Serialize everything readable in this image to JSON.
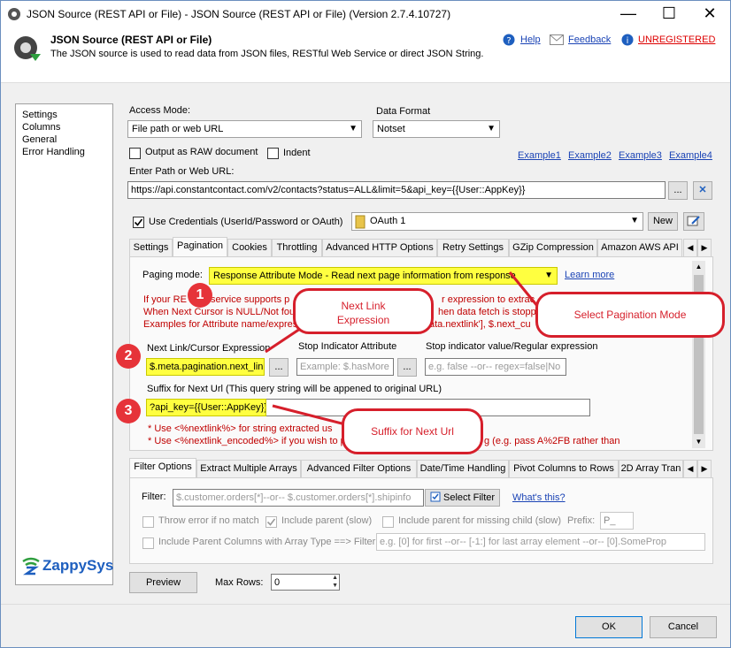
{
  "window": {
    "title": "JSON Source (REST API or File) - JSON Source (REST API or File) (Version 2.7.4.10727)",
    "minimize": "—",
    "maximize": "☐",
    "close": "✕"
  },
  "header": {
    "title": "JSON Source (REST API or File)",
    "description": "The JSON source is used to read data from JSON files, RESTful Web Service or direct JSON String.",
    "help": "Help",
    "feedback": "Feedback",
    "unregistered": "UNREGISTERED"
  },
  "leftnav": {
    "items": [
      "Settings",
      "Columns",
      "General",
      "Error Handling"
    ]
  },
  "access_mode": {
    "label": "Access Mode:",
    "value": "File path or web URL"
  },
  "data_format": {
    "label": "Data Format",
    "value": "Notset"
  },
  "output_raw": {
    "label": "Output as RAW document"
  },
  "indent": {
    "label": "Indent"
  },
  "examples": [
    "Example1",
    "Example2",
    "Example3",
    "Example4"
  ],
  "path": {
    "label": "Enter Path or Web URL:",
    "value": "https://api.constantcontact.com/v2/contacts?status=ALL&limit=5&api_key={{User::AppKey}}",
    "browse": "...",
    "clear": "✕"
  },
  "credentials": {
    "label": "Use Credentials (UserId/Password or OAuth)",
    "value": "OAuth 1",
    "new": "New"
  },
  "tabs": [
    "Settings",
    "Pagination",
    "Cookies",
    "Throttling",
    "Advanced HTTP Options",
    "Retry Settings",
    "GZip Compression",
    "Amazon AWS API"
  ],
  "pagination": {
    "paging_label": "Paging mode:",
    "paging_value": "Response Attribute Mode - Read next page information from response",
    "learn_more": "Learn more",
    "info_1a": "If your RE",
    "info_1b": "service supports p",
    "info_1c": "r expression to extrac",
    "info_2a": "When Next Cursor is NULL/Not fou",
    "info_2b": "hen data fetch is stopp",
    "info_3a": "Examples for Attribute name/expres",
    "info_3b": "ata.nextlink'], $.next_cu",
    "next_link_label": "Next Link/Cursor Expression",
    "next_link_value": "$.meta.pagination.next_link",
    "stop_attr_label": "Stop Indicator Attribute",
    "stop_attr_ph": "Example:  $.hasMore",
    "stop_val_label": "Stop indicator value/Regular expression",
    "stop_val_ph": "e.g. false --or-- regex=false|No",
    "suffix_label": "Suffix for Next Url  (This query string will be appened to original URL)",
    "suffix_value": "?api_key={{User::AppKey}}",
    "note_1a": "* Use <%nextlink%> for string extracted us",
    "note_2a": "* Use <%nextlink_encoded%> if you wish to p",
    "note_2b": "g (e.g. pass A%2FB rather than",
    "browse": "..."
  },
  "callouts": {
    "next_link": "Next Link\nExpression",
    "select_mode": "Select Pagination Mode",
    "suffix": "Suffix for Next Url",
    "n1": "1",
    "n2": "2",
    "n3": "3"
  },
  "filter_tabs": [
    "Filter Options",
    "Extract Multiple Arrays",
    "Advanced Filter Options",
    "Date/Time Handling",
    "Pivot Columns to Rows",
    "2D Array Tran"
  ],
  "filter": {
    "label": "Filter:",
    "placeholder": "$.customer.orders[*]--or-- $.customer.orders[*].shipinfo",
    "select": "Select Filter",
    "whats_this": "What's this?",
    "throw_error": "Throw error if no match",
    "include_parent": "Include parent (slow)",
    "include_missing": "Include parent for missing child (slow)",
    "prefix_label": "Prefix:",
    "prefix_value": "P_",
    "include_cols": "Include Parent Columns with Array Type ==> Filter :",
    "include_cols_ph": "e.g. [0] for first --or-- [-1:] for last array element --or-- [0].SomeProp"
  },
  "logo": {
    "text": "ZappySys"
  },
  "footer": {
    "preview": "Preview",
    "max_rows_label": "Max Rows:",
    "max_rows": "0",
    "ok": "OK",
    "cancel": "Cancel"
  },
  "colors": {
    "accent_red": "#d61f2b",
    "highlight": "#ffff40",
    "link": "#1a43b5"
  }
}
